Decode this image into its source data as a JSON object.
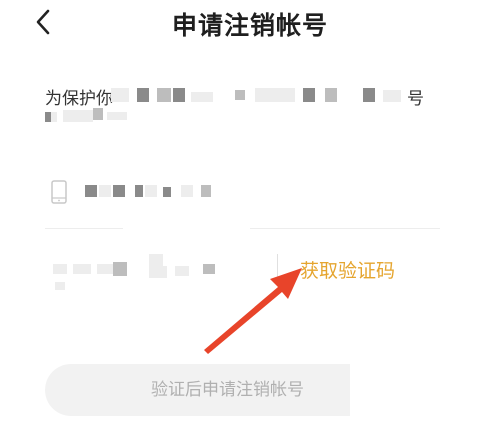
{
  "header": {
    "title": "申请注销帐号"
  },
  "notice": {
    "prefix": "为保护你",
    "suffix": "号"
  },
  "verification": {
    "get_code_label": "获取验证码",
    "code_placeholder": ""
  },
  "submit": {
    "label": "验证后申请注销帐号"
  },
  "colors": {
    "accent": "#e5a52f",
    "arrow": "#e8442a",
    "button_bg": "#f2f2f2",
    "button_text": "#b0b0b0"
  },
  "icons": {
    "back": "chevron-left-icon",
    "phone": "phone-icon",
    "annotation": "red-arrow-annotation"
  }
}
